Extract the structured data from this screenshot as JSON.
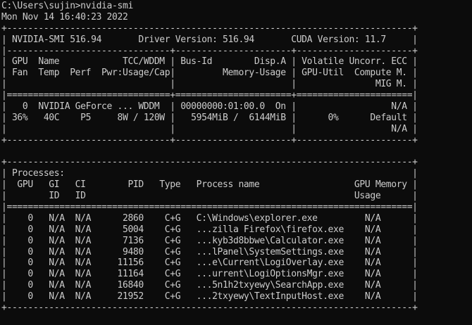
{
  "terminal": {
    "colors": {
      "background": "#0c0c0c",
      "foreground": "#cccccc"
    },
    "lines": [
      "C:\\Users\\sujin>nvidia-smi",
      "Mon Nov 14 16:40:23 2022",
      "+-----------------------------------------------------------------------------+",
      "| NVIDIA-SMI 516.94       Driver Version: 516.94       CUDA Version: 11.7     |",
      "|-------------------------------+----------------------+----------------------+",
      "| GPU  Name            TCC/WDDM | Bus-Id        Disp.A | Volatile Uncorr. ECC |",
      "| Fan  Temp  Perf  Pwr:Usage/Cap|         Memory-Usage | GPU-Util  Compute M. |",
      "|                               |                      |               MIG M. |",
      "|===============================+======================+======================|",
      "|   0  NVIDIA GeForce ... WDDM  | 00000000:01:00.0  On |                  N/A |",
      "| 36%   40C    P5     8W / 120W |   5954MiB /  6144MiB |      0%      Default |",
      "|                               |                      |                  N/A |",
      "+-------------------------------+----------------------+----------------------+",
      "",
      "+-----------------------------------------------------------------------------+",
      "| Processes:                                                                  |",
      "|  GPU   GI   CI        PID   Type   Process name                  GPU Memory |",
      "|        ID   ID                                                   Usage      |",
      "|=============================================================================|",
      "|    0   N/A  N/A      2860    C+G   C:\\Windows\\explorer.exe         N/A      |",
      "|    0   N/A  N/A      5004    C+G   ...zilla Firefox\\firefox.exe    N/A      |",
      "|    0   N/A  N/A      7136    C+G   ...kyb3d8bbwe\\Calculator.exe    N/A      |",
      "|    0   N/A  N/A      9480    C+G   ...lPanel\\SystemSettings.exe    N/A      |",
      "|    0   N/A  N/A     11156    C+G   ...e\\Current\\LogiOverlay.exe    N/A      |",
      "|    0   N/A  N/A     11164    C+G   ...urrent\\LogiOptionsMgr.exe    N/A      |",
      "|    0   N/A  N/A     16840    C+G   ...5n1h2txyewy\\SearchApp.exe    N/A      |",
      "|    0   N/A  N/A     21952    C+G   ...2txyewy\\TextInputHost.exe    N/A      |",
      "+-----------------------------------------------------------------------------+"
    ]
  }
}
